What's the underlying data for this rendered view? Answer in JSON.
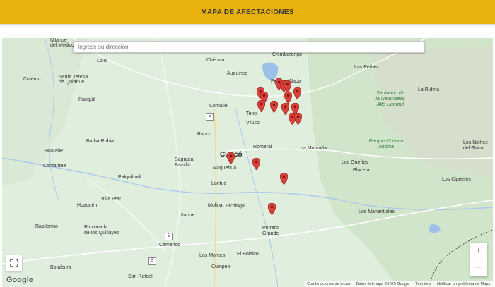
{
  "header": {
    "title": "MAPA DE AFECTACIONES"
  },
  "search": {
    "placeholder": "Ingrese su dirección"
  },
  "places": [
    {
      "name": "Nilahue\ndel Médico",
      "key": "nilahue"
    },
    {
      "name": "Chimbarongo",
      "key": "chimbarongo"
    },
    {
      "name": "Loiol",
      "key": "loiol"
    },
    {
      "name": "Chépica",
      "key": "chepica"
    },
    {
      "name": "Auquinco",
      "key": "auquinco"
    },
    {
      "name": "Peor es Nada",
      "key": "peor"
    },
    {
      "name": "Las Peñas",
      "key": "lpenas"
    },
    {
      "name": "Cutemu",
      "key": "cutemu"
    },
    {
      "name": "Santa Teresa\nde Quiahue",
      "key": "steresa"
    },
    {
      "name": "La Rufina",
      "key": "rufina"
    },
    {
      "name": "Santuario de\nla Naturaleza\nAlto Huemul",
      "key": "santuario"
    },
    {
      "name": "Rangüil",
      "key": "ranguil"
    },
    {
      "name": "Comalle",
      "key": "comalle"
    },
    {
      "name": "Teno",
      "key": "teno"
    },
    {
      "name": "Viluco",
      "key": "viluco"
    },
    {
      "name": "Rauco",
      "key": "rauco"
    },
    {
      "name": "Barba Rubia",
      "key": "barba"
    },
    {
      "name": "Parque Cuenca\nAndina",
      "key": "parque"
    },
    {
      "name": "Romeral",
      "key": "romeral"
    },
    {
      "name": "La Montaña",
      "key": "montana"
    },
    {
      "name": "Los Niches\ndel Flaco",
      "key": "flaco"
    },
    {
      "name": "Hualañé",
      "key": "hualane"
    },
    {
      "name": "Curicó",
      "key": "curico"
    },
    {
      "name": "Sagrada\nFamilia",
      "key": "sagrada"
    },
    {
      "name": "Los Queñes",
      "key": "quenes"
    },
    {
      "name": "Contantue",
      "key": "contantue"
    },
    {
      "name": "Maquehua",
      "key": "maquehua"
    },
    {
      "name": "Placeta",
      "key": "placeta"
    },
    {
      "name": "Palquibudi",
      "key": "palquibudi"
    },
    {
      "name": "Lontué",
      "key": "lontue"
    },
    {
      "name": "Los Cipreses",
      "key": "cipreses"
    },
    {
      "name": "Villa Prat",
      "key": "villaprat"
    },
    {
      "name": "Huaquén",
      "key": "huaquen"
    },
    {
      "name": "Molina",
      "key": "molina"
    },
    {
      "name": "Pichingal",
      "key": "pichingal"
    },
    {
      "name": "Itahue",
      "key": "itahue"
    },
    {
      "name": "Los Manantiales",
      "key": "manantiales"
    },
    {
      "name": "Rapilermo",
      "key": "rapilermo"
    },
    {
      "name": "Rinconada\nde los Quillayes",
      "key": "rinconada"
    },
    {
      "name": "Potrero\nGrande",
      "key": "potrero"
    },
    {
      "name": "Camarico",
      "key": "camarico"
    },
    {
      "name": "Los Montes",
      "key": "montes"
    },
    {
      "name": "El Bolsico",
      "key": "bolsico"
    },
    {
      "name": "Cumpeo",
      "key": "cumpeo"
    },
    {
      "name": "Botalcura",
      "key": "botalcura"
    },
    {
      "name": "San Rafael",
      "key": "srafael"
    }
  ],
  "road_shields": [
    "5",
    "5",
    "5"
  ],
  "pins": {
    "color": "#d9413a",
    "count": 19
  },
  "controls": {
    "zoom_in": "+",
    "zoom_out": "−",
    "logo": "Google"
  },
  "footer": {
    "shortcuts": "Combinaciones de teclas",
    "map_data": "Datos del mapa ©2025 Google",
    "terms": "Términos",
    "report": "Notificar un problema de Maps"
  },
  "colors": {
    "header": "#e9b10c",
    "map_bg": "#dfeedd",
    "water": "#9cc0e8",
    "mountain": "#cfe3c8"
  }
}
